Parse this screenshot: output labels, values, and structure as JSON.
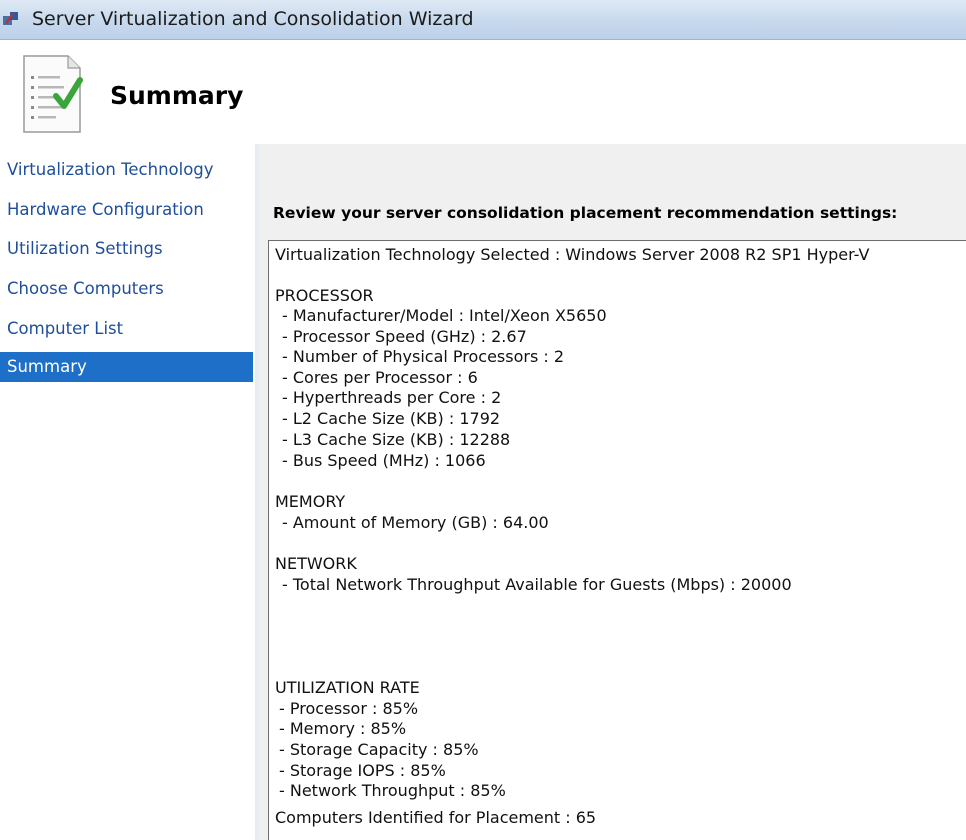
{
  "window": {
    "title": "Server Virtualization and Consolidation Wizard"
  },
  "header": {
    "title": "Summary",
    "icon": "document-check-icon"
  },
  "sidebar": {
    "items": [
      {
        "label": "Virtualization Technology",
        "selected": false
      },
      {
        "label": "Hardware Configuration",
        "selected": false
      },
      {
        "label": "Utilization Settings",
        "selected": false
      },
      {
        "label": "Choose Computers",
        "selected": false
      },
      {
        "label": "Computer List",
        "selected": false
      },
      {
        "label": "Summary",
        "selected": true
      }
    ]
  },
  "main": {
    "review_label": "Review your server consolidation placement recommendation settings:",
    "summary": {
      "virtualization": "Virtualization Technology Selected : Windows Server 2008 R2 SP1 Hyper-V",
      "processor_heading": "PROCESSOR",
      "processor": [
        "- Manufacturer/Model : Intel/Xeon X5650",
        "- Processor Speed (GHz) : 2.67",
        "- Number of Physical Processors : 2",
        "- Cores per Processor : 6",
        "- Hyperthreads per Core : 2",
        "- L2 Cache Size (KB) : 1792",
        "- L3 Cache Size (KB) : 12288",
        "- Bus Speed (MHz) : 1066"
      ],
      "memory_heading": "MEMORY",
      "memory": [
        "- Amount of Memory (GB) : 64.00"
      ],
      "network_heading": "NETWORK",
      "network": [
        "- Total Network Throughput Available for Guests (Mbps) : 20000"
      ],
      "utilization_heading": "UTILIZATION RATE",
      "utilization": [
        "- Processor : 85%",
        "- Memory : 85%",
        "- Storage Capacity : 85%",
        "- Storage IOPS : 85%",
        "- Network Throughput : 85%"
      ],
      "computers_identified": "Computers Identified for Placement : 65"
    }
  },
  "colors": {
    "selected_bg": "#1e6fc8",
    "nav_link": "#1f4e9a",
    "check_green": "#3aa53a"
  }
}
